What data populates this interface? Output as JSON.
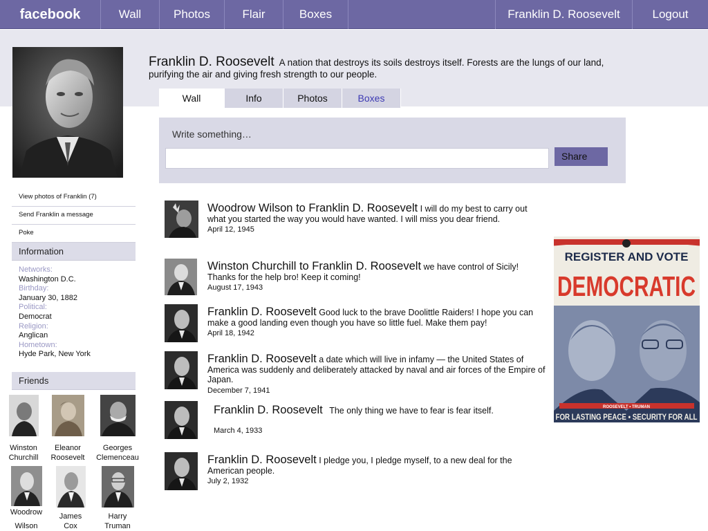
{
  "nav": {
    "brand": "facebook",
    "items": [
      "Wall",
      "Photos",
      "Flair",
      "Boxes"
    ],
    "user": "Franklin D. Roosevelt",
    "logout": "Logout"
  },
  "header": {
    "name": "Franklin D. Roosevelt",
    "status": "A nation that destroys its soils destroys itself. Forests are the lungs of our land, purifying the air and giving fresh strength to our people."
  },
  "tabs": [
    "Wall",
    "Info",
    "Photos",
    "Boxes"
  ],
  "composer": {
    "label": "Write something…",
    "value": "",
    "share": "Share"
  },
  "left": {
    "links": [
      "View photos of Franklin (7)",
      "Send Franklin a message",
      "Poke"
    ],
    "info_title": "Information",
    "info": [
      {
        "label": "Networks:",
        "value": "Washington D.C."
      },
      {
        "label": "Birthday:",
        "value": "January 30, 1882"
      },
      {
        "label": "Political:",
        "value": "Democrat"
      },
      {
        "label": "Religion:",
        "value": "Anglican"
      },
      {
        "label": "Hometown:",
        "value": "Hyde Park, New  York"
      }
    ],
    "friends_title": "Friends",
    "friends": [
      {
        "line1": "Winston",
        "line2": "Churchill"
      },
      {
        "line1": "Eleanor",
        "line2": "Roosevelt"
      },
      {
        "line1": "Georges",
        "line2": "Clemenceau"
      },
      {
        "line1": "Woodrow",
        "line2": "Wilson"
      },
      {
        "line1": "James",
        "line2": "Cox"
      },
      {
        "line1": "Harry",
        "line2": "Truman"
      }
    ]
  },
  "posts": [
    {
      "title": "Woodrow Wilson to Franklin D. Roosevelt",
      "text": "I will do my best to carry out what you started the way you would have wanted. I will miss you dear friend.",
      "date": "April 12, 1945"
    },
    {
      "title": "Winston Churchill to Franklin D. Roosevelt",
      "text": "we have control of Sicily! Thanks for the help bro! Keep it coming!",
      "date": "August 17, 1943"
    },
    {
      "title": "Franklin D. Roosevelt",
      "text": "Good luck to the brave Doolittle Raiders! I hope you can make a good landing even though you have so little fuel.  Make them pay!",
      "date": "April 18, 1942"
    },
    {
      "title": "Franklin D. Roosevelt",
      "text": "a date which will live in infamy — the United States of America was suddenly and deliberately attacked by naval and air forces of the Empire of Japan.",
      "date": "December 7, 1941"
    },
    {
      "title": "Franklin D. Roosevelt",
      "text": "The only thing we have to fear is fear itself.",
      "date": "March 4, 1933"
    },
    {
      "title": "Franklin D. Roosevelt",
      "text": "I pledge you, I pledge myself, to a new deal for the American people.",
      "date": "July 2, 1932"
    }
  ],
  "poster": {
    "line1": "REGISTER AND VOTE",
    "line2": "DEMOCRATIC",
    "names": "ROOSEVELT  •  TRUMAN",
    "footer": "FOR LASTING PEACE • SECURITY FOR ALL"
  }
}
